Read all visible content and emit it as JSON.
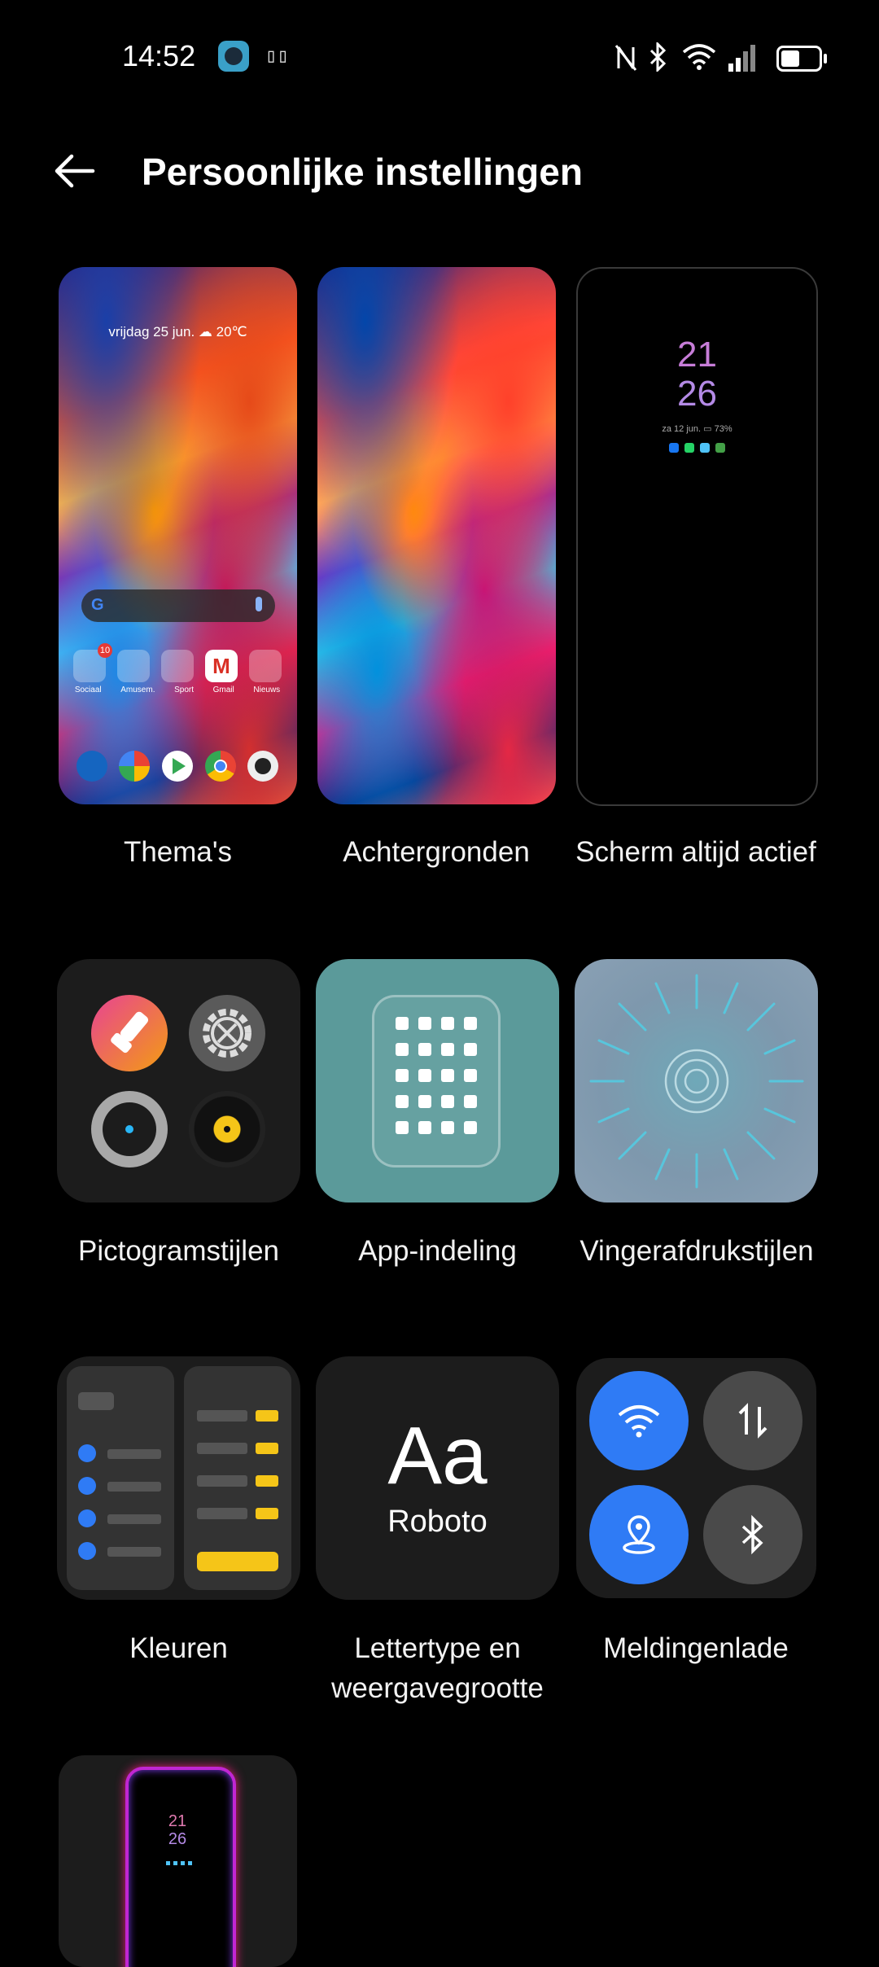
{
  "status_bar": {
    "time": "14:52",
    "icons": [
      "app-notification-icon",
      "sim-icon",
      "nfc-icon",
      "bluetooth-icon",
      "wifi-icon",
      "signal-icon",
      "battery-icon"
    ]
  },
  "header": {
    "title": "Persoonlijke instellingen"
  },
  "theme_preview": {
    "date_weather": "vrijdag 25 jun.   ☁ 20℃",
    "apps": [
      "Sociaal",
      "Amusem.",
      "Sport",
      "Gmail",
      "Nieuws"
    ],
    "badge": "10"
  },
  "aod_preview": {
    "hour": "21",
    "minute": "26",
    "info": "za 12 jun.  ▭ 73%"
  },
  "tiles": [
    {
      "label": "Thema's"
    },
    {
      "label": "Achtergronden"
    },
    {
      "label": "Scherm altijd actief"
    },
    {
      "label": "Pictogramstijlen"
    },
    {
      "label": "App-indeling"
    },
    {
      "label": "Vingerafdrukstijlen"
    },
    {
      "label": "Kleuren"
    },
    {
      "label": "Lettertype en weergavegrootte"
    },
    {
      "label": "Meldingenlade"
    }
  ],
  "font_preview": {
    "sample": "Aa",
    "font_name": "Roboto"
  },
  "edge_preview": {
    "hour": "21",
    "minute": "26"
  },
  "colors": {
    "accent_blue": "#2f7bf5",
    "accent_yellow": "#f5c518",
    "app_layout_bg": "#5b9a9a",
    "fingerprint_bg": "#7e98ad"
  }
}
